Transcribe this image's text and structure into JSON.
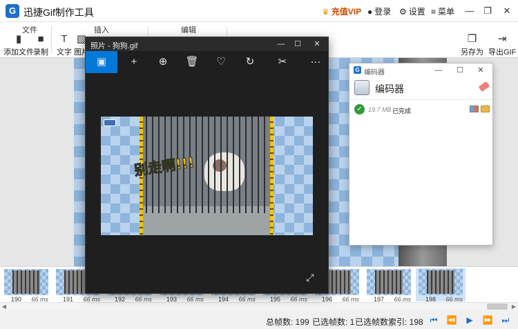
{
  "app": {
    "title": "迅捷Gif制作工具",
    "logo_letter": "G",
    "vip_label": "充值VIP",
    "login_label": "登录",
    "settings_label": "设置",
    "menu_label": "菜单",
    "controls": {
      "minimize": "—",
      "restore": "❐",
      "close": "✕"
    }
  },
  "ribbon": {
    "groups": [
      {
        "label": "文件"
      },
      {
        "label": "插入"
      },
      {
        "label": "编辑"
      }
    ],
    "buttons": {
      "add_file": "添加文件",
      "record": "录制",
      "text": "文字",
      "image": "图片",
      "save_as": "另存为",
      "export_gif": "导出GIF"
    }
  },
  "filmstrip": {
    "frames": [
      {
        "num": "190",
        "ms": "66 ms"
      },
      {
        "num": "191",
        "ms": "66 ms"
      },
      {
        "num": "192",
        "ms": "66 ms"
      },
      {
        "num": "193",
        "ms": "66 ms"
      },
      {
        "num": "194",
        "ms": "66 ms"
      },
      {
        "num": "195",
        "ms": "66 ms"
      },
      {
        "num": "196",
        "ms": "66 ms"
      },
      {
        "num": "197",
        "ms": "66 ms"
      },
      {
        "num": "198",
        "ms": "66 ms"
      }
    ],
    "selected_frame": "198"
  },
  "status": {
    "total_frames": "总帧数: 199",
    "selected_frames": "已选帧数: 1",
    "selected_index": "已选帧数索引: 198"
  },
  "photos": {
    "title": "照片 - 狗狗.gif",
    "shout_text": "别走啊!!!",
    "controls": {
      "minimize": "—",
      "restore": "☐",
      "close": "✕"
    },
    "tools": {
      "view": "▣",
      "add": "+",
      "zoom": "⊕",
      "delete": "🗑",
      "favorite": "♡",
      "rotate": "↻",
      "edit": "✂",
      "more": "···"
    },
    "expand": "⤢"
  },
  "encoder": {
    "window_title": "编码器",
    "header": "编码器",
    "item_size": "19.7 MB",
    "item_status": "已完成",
    "controls": {
      "minimize": "—",
      "restore": "☐",
      "close": "✕"
    }
  },
  "colors": {
    "accent": "#1e6fc9",
    "photos_active": "#0078d7",
    "vip": "#d04a00",
    "success": "#2e9b3a"
  }
}
